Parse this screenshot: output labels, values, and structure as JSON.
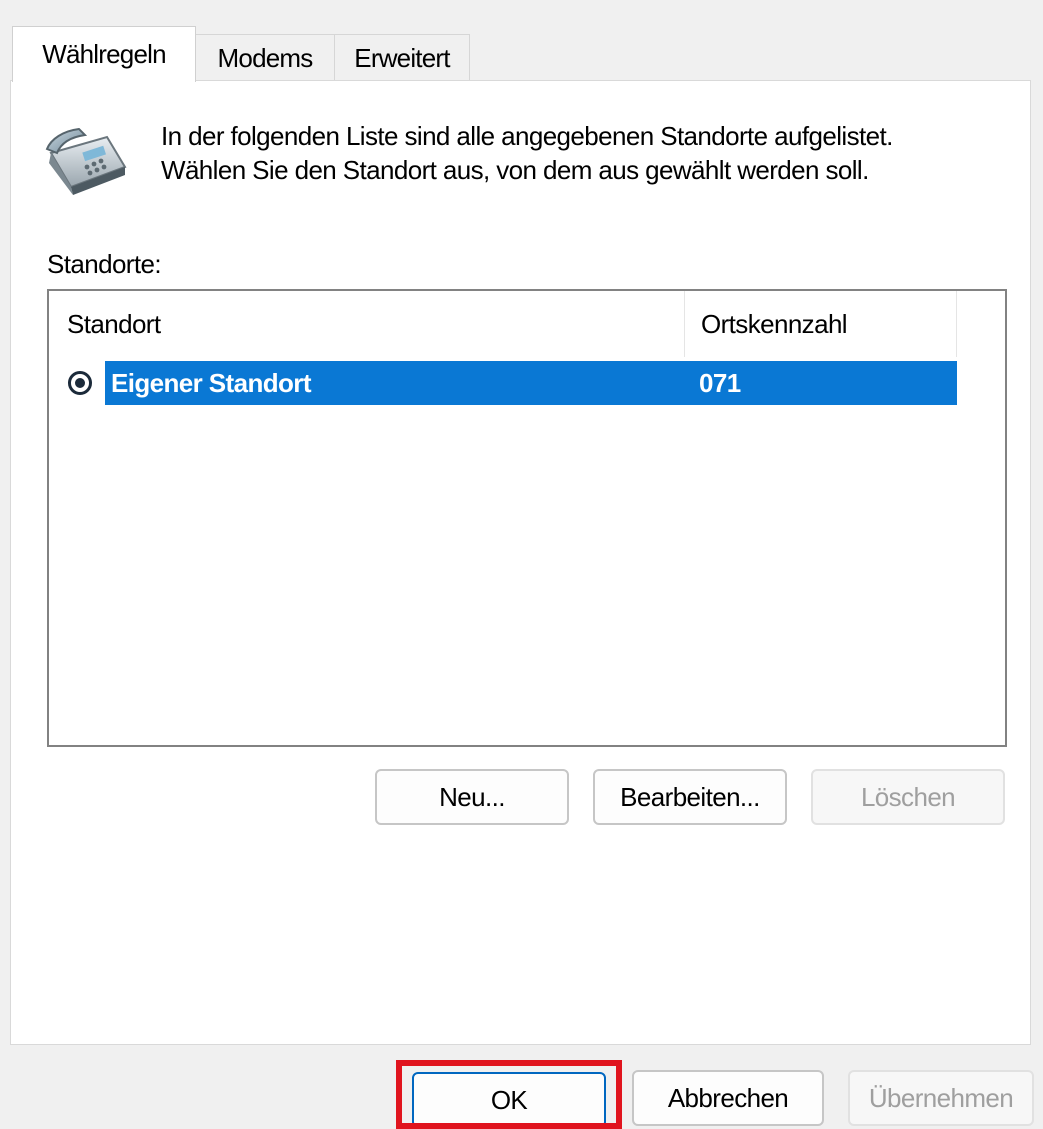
{
  "tabs": [
    {
      "label": "Wählregeln",
      "active": true
    },
    {
      "label": "Modems",
      "active": false
    },
    {
      "label": "Erweitert",
      "active": false
    }
  ],
  "intro": {
    "line1": "In der folgenden Liste sind alle angegebenen Standorte aufgelistet.",
    "line2": "Wählen Sie den Standort aus, von dem aus gewählt werden soll."
  },
  "icon": "telephone-icon",
  "locations": {
    "label": "Standorte:",
    "columns": [
      "Standort",
      "Ortskennzahl"
    ],
    "rows": [
      {
        "name": "Eigener Standort",
        "area_code": "071",
        "selected": true
      }
    ]
  },
  "list_buttons": {
    "new": "Neu...",
    "edit": "Bearbeiten...",
    "delete": "Löschen"
  },
  "footer_buttons": {
    "ok": "OK",
    "cancel": "Abbrechen",
    "apply": "Übernehmen"
  },
  "colors": {
    "selection": "#0a78d4",
    "highlight": "#e0141e",
    "default_button_border": "#0067c0"
  }
}
